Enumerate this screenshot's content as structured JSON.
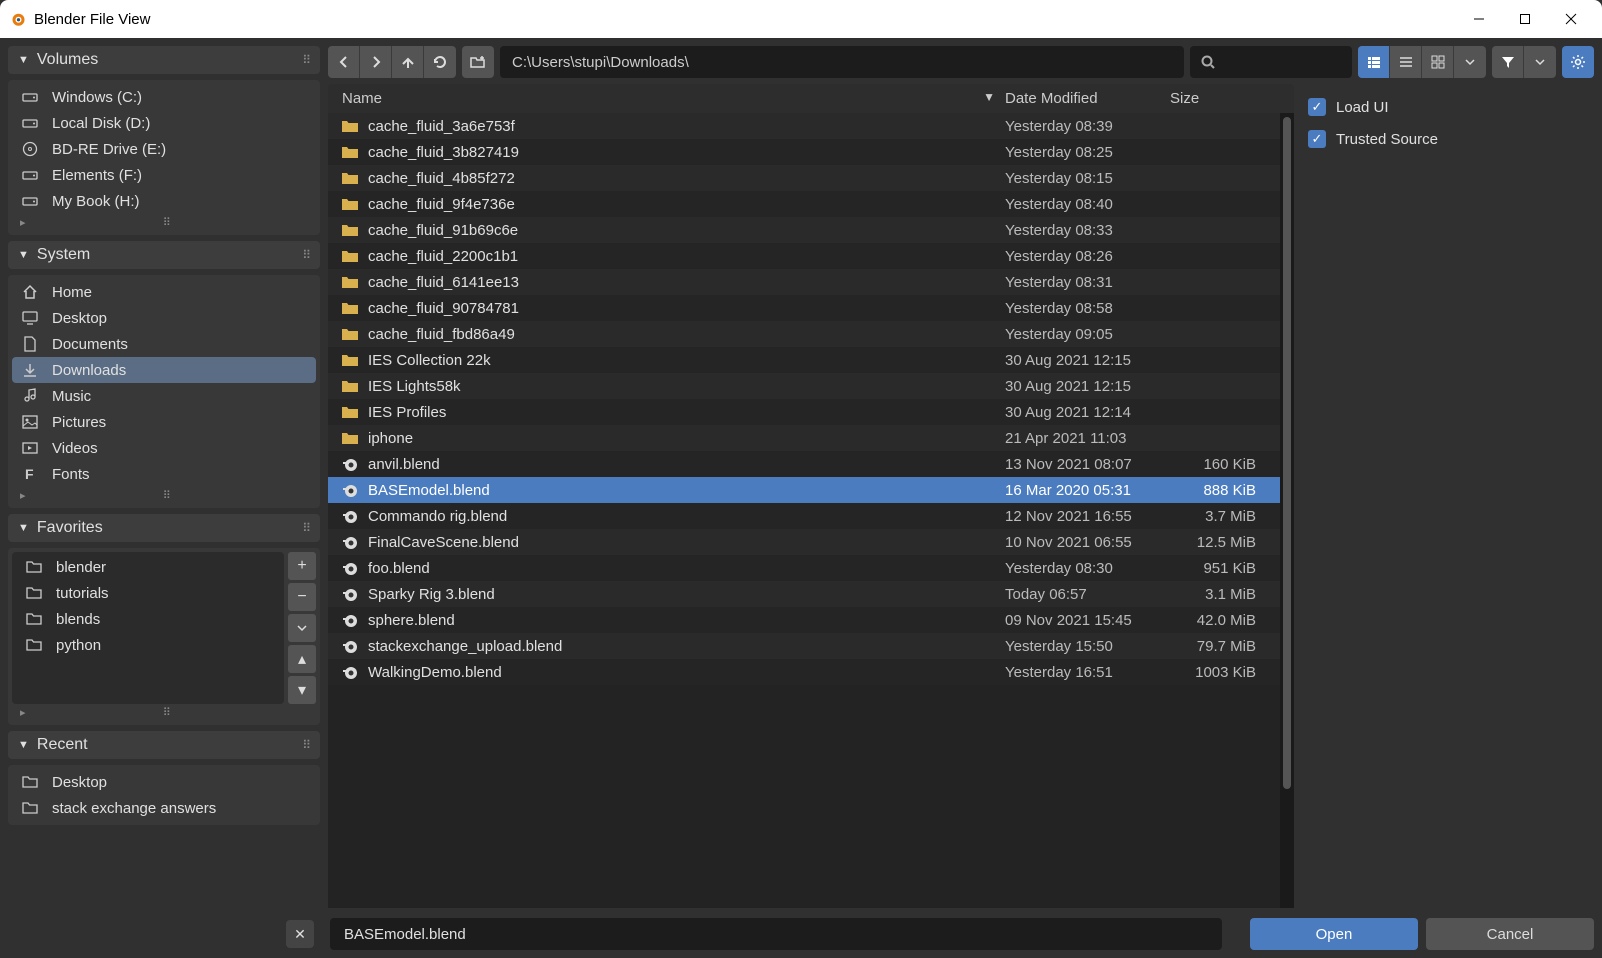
{
  "window": {
    "title": "Blender File View"
  },
  "toolbar": {
    "path": "C:\\Users\\stupi\\Downloads\\"
  },
  "sidebar": {
    "volumes": {
      "title": "Volumes",
      "items": [
        {
          "label": "Windows (C:)"
        },
        {
          "label": "Local Disk (D:)"
        },
        {
          "label": "BD-RE Drive (E:)"
        },
        {
          "label": "Elements (F:)"
        },
        {
          "label": "My Book (H:)"
        }
      ]
    },
    "system": {
      "title": "System",
      "items": [
        {
          "label": "Home"
        },
        {
          "label": "Desktop"
        },
        {
          "label": "Documents"
        },
        {
          "label": "Downloads",
          "selected": true
        },
        {
          "label": "Music"
        },
        {
          "label": "Pictures"
        },
        {
          "label": "Videos"
        },
        {
          "label": "Fonts"
        }
      ]
    },
    "favorites": {
      "title": "Favorites",
      "items": [
        {
          "label": "blender"
        },
        {
          "label": "tutorials"
        },
        {
          "label": "blends"
        },
        {
          "label": "python"
        }
      ]
    },
    "recent": {
      "title": "Recent",
      "items": [
        {
          "label": "Desktop"
        },
        {
          "label": "stack exchange answers"
        }
      ]
    }
  },
  "columns": {
    "name": "Name",
    "date": "Date Modified",
    "size": "Size"
  },
  "files": [
    {
      "type": "folder",
      "name": "cache_fluid_3a6e753f",
      "date": "Yesterday 08:39",
      "size": ""
    },
    {
      "type": "folder",
      "name": "cache_fluid_3b827419",
      "date": "Yesterday 08:25",
      "size": ""
    },
    {
      "type": "folder",
      "name": "cache_fluid_4b85f272",
      "date": "Yesterday 08:15",
      "size": ""
    },
    {
      "type": "folder",
      "name": "cache_fluid_9f4e736e",
      "date": "Yesterday 08:40",
      "size": ""
    },
    {
      "type": "folder",
      "name": "cache_fluid_91b69c6e",
      "date": "Yesterday 08:33",
      "size": ""
    },
    {
      "type": "folder",
      "name": "cache_fluid_2200c1b1",
      "date": "Yesterday 08:26",
      "size": ""
    },
    {
      "type": "folder",
      "name": "cache_fluid_6141ee13",
      "date": "Yesterday 08:31",
      "size": ""
    },
    {
      "type": "folder",
      "name": "cache_fluid_90784781",
      "date": "Yesterday 08:58",
      "size": ""
    },
    {
      "type": "folder",
      "name": "cache_fluid_fbd86a49",
      "date": "Yesterday 09:05",
      "size": ""
    },
    {
      "type": "folder",
      "name": "IES Collection 22k",
      "date": "30 Aug 2021 12:15",
      "size": ""
    },
    {
      "type": "folder",
      "name": "IES Lights58k",
      "date": "30 Aug 2021 12:15",
      "size": ""
    },
    {
      "type": "folder",
      "name": "IES Profiles",
      "date": "30 Aug 2021 12:14",
      "size": ""
    },
    {
      "type": "folder",
      "name": "iphone",
      "date": "21 Apr 2021 11:03",
      "size": ""
    },
    {
      "type": "blend",
      "name": "anvil.blend",
      "date": "13 Nov 2021 08:07",
      "size": "160 KiB"
    },
    {
      "type": "blend",
      "name": "BASEmodel.blend",
      "date": "16 Mar 2020 05:31",
      "size": "888 KiB",
      "selected": true
    },
    {
      "type": "blend",
      "name": "Commando rig.blend",
      "date": "12 Nov 2021 16:55",
      "size": "3.7 MiB"
    },
    {
      "type": "blend",
      "name": "FinalCaveScene.blend",
      "date": "10 Nov 2021 06:55",
      "size": "12.5 MiB"
    },
    {
      "type": "blend",
      "name": "foo.blend",
      "date": "Yesterday 08:30",
      "size": "951 KiB"
    },
    {
      "type": "blend",
      "name": "Sparky Rig 3.blend",
      "date": "Today 06:57",
      "size": "3.1 MiB"
    },
    {
      "type": "blend",
      "name": "sphere.blend",
      "date": "09 Nov 2021 15:45",
      "size": "42.0 MiB"
    },
    {
      "type": "blend",
      "name": "stackexchange_upload.blend",
      "date": "Yesterday 15:50",
      "size": "79.7 MiB"
    },
    {
      "type": "blend",
      "name": "WalkingDemo.blend",
      "date": "Yesterday 16:51",
      "size": "1003 KiB"
    }
  ],
  "options": {
    "load_ui": "Load UI",
    "trusted_source": "Trusted Source"
  },
  "footer": {
    "filename": "BASEmodel.blend",
    "open": "Open",
    "cancel": "Cancel"
  }
}
